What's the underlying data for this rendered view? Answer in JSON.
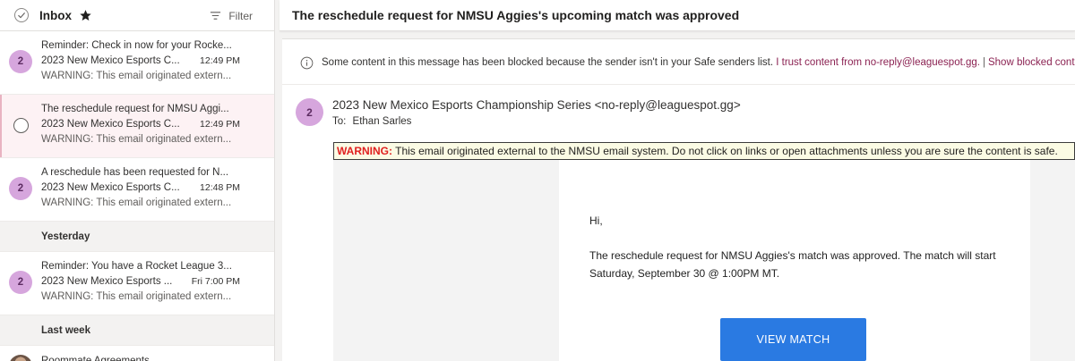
{
  "list_header": {
    "folder": "Inbox",
    "filter_label": "Filter"
  },
  "messages": [
    {
      "avatar": "2",
      "subject": "Reminder: Check in now for your Rocke...",
      "sender": "2023 New Mexico Esports C...",
      "time": "12:49 PM",
      "preview": "WARNING: This email originated extern..."
    },
    {
      "avatar": "",
      "subject": "The reschedule request for NMSU Aggi...",
      "sender": "2023 New Mexico Esports C...",
      "time": "12:49 PM",
      "preview": "WARNING: This email originated extern..."
    },
    {
      "avatar": "2",
      "subject": "A reschedule has been requested for N...",
      "sender": "2023 New Mexico Esports C...",
      "time": "12:48 PM",
      "preview": "WARNING: This email originated extern..."
    },
    {
      "avatar": "2",
      "subject": "Reminder: You have a Rocket League 3...",
      "sender": "2023 New Mexico Esports ...",
      "time": "Fri 7:00 PM",
      "preview": "WARNING: This email originated extern..."
    },
    {
      "subject": "Roommate Agreements"
    }
  ],
  "groups": {
    "yesterday": "Yesterday",
    "last_week": "Last week"
  },
  "reading": {
    "subject": "The reschedule request for NMSU Aggies's upcoming match was approved",
    "blocked_notice": "Some content in this message has been blocked because the sender isn't in your Safe senders list.",
    "trust_link": "I trust content from no-reply@leaguespot.gg.",
    "separator": "|",
    "show_blocked_link": "Show blocked content",
    "sender_avatar": "2",
    "sender": "2023 New Mexico Esports Championship Series <no-reply@leaguespot.gg>",
    "to_label": "To:",
    "to_name": "Ethan Sarles",
    "warning_label": "WARNING:",
    "warning_text": " This email originated external to the NMSU email system. Do not click on links or open attachments unless you are sure the content is safe.",
    "greeting": "Hi,",
    "body": "The reschedule request for NMSU Aggies's match was approved. The match will start Saturday, September 30 @ 1:00PM MT.",
    "button": "VIEW MATCH"
  },
  "colors": {
    "avatar_bg": "#d6a6dd",
    "selected_bg": "#fdf2f4",
    "button_bg": "#2a7ae2",
    "warning_red": "#e02020",
    "link": "#8b2252"
  }
}
